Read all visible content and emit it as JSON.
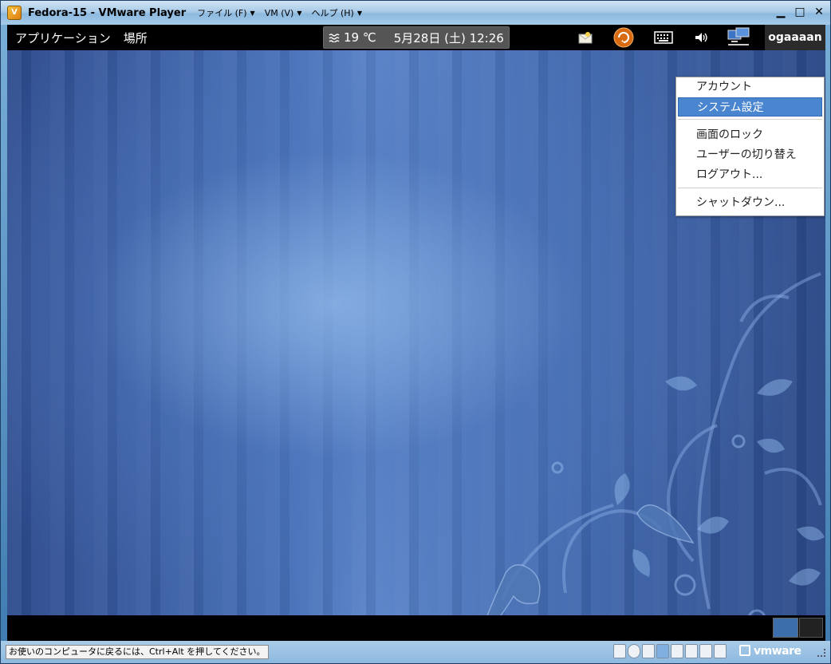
{
  "window": {
    "title": "Fedora-15 - VMware Player",
    "app_icon": "vmware-player-icon",
    "menus": [
      {
        "label": "ファイル (F)"
      },
      {
        "label": "VM (V)"
      },
      {
        "label": "ヘルプ (H)"
      }
    ],
    "controls": {
      "minimize": "▁",
      "maximize": "□",
      "close": "✕"
    }
  },
  "guest": {
    "topbar": {
      "applications": "アプリケーション",
      "places": "場所",
      "weather": "19 ℃",
      "weather_icon": "fog-icon",
      "datetime": "5月28日 (土) 12:26",
      "tray_icons": [
        "message-icon",
        "updates-icon",
        "keyboard-icon",
        "volume-icon",
        "network-icon"
      ],
      "user": "ogaaaan"
    },
    "user_menu": {
      "items": [
        {
          "label": "アカウント",
          "selected": false
        },
        {
          "label": "システム設定",
          "selected": true
        },
        {
          "label": "画面のロック",
          "selected": false
        },
        {
          "label": "ユーザーの切り替え",
          "selected": false
        },
        {
          "label": "ログアウト...",
          "selected": false
        },
        {
          "label": "シャットダウン...",
          "selected": false
        }
      ]
    }
  },
  "statusbar": {
    "hint": "お使いのコンピュータに戻るには、Ctrl+Alt を押してください。",
    "device_icons": [
      "hdd-icon",
      "cdrom-icon",
      "floppy-icon",
      "network-adapter-icon",
      "usb-icon",
      "sound-icon",
      "printer-icon",
      "message-log-icon"
    ],
    "brand": "vmware"
  }
}
